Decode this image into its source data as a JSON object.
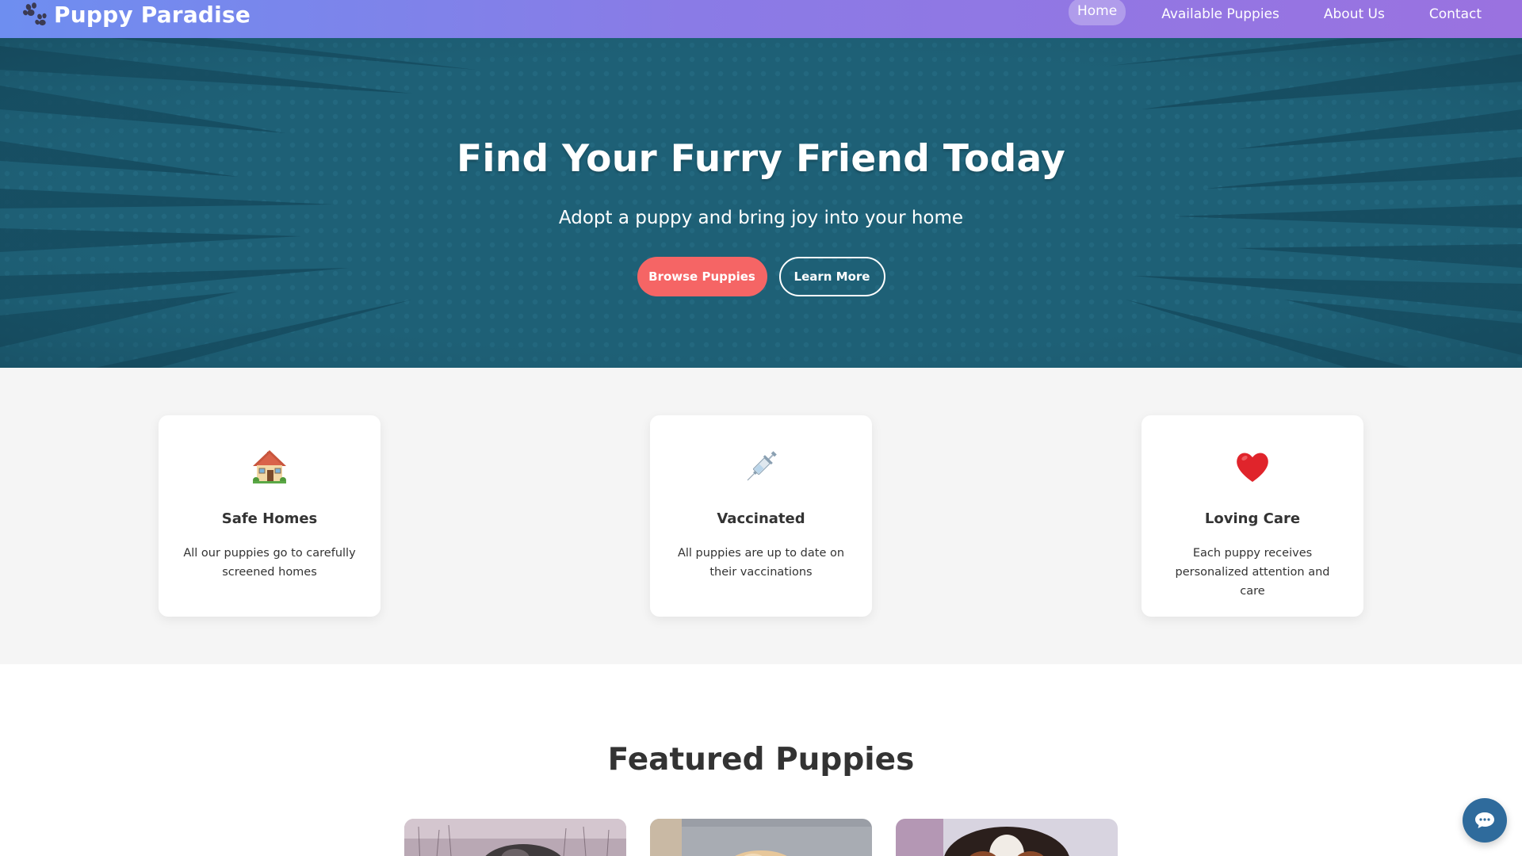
{
  "brand": {
    "title": "Puppy Paradise",
    "logo_icon": "paw-icon"
  },
  "nav": {
    "items": [
      {
        "label": "Home",
        "active": true
      },
      {
        "label": "Available Puppies",
        "active": false
      },
      {
        "label": "About Us",
        "active": false
      },
      {
        "label": "Contact",
        "active": false
      }
    ]
  },
  "hero": {
    "title": "Find Your Furry Friend Today",
    "subtitle": "Adopt a puppy and bring joy into your home",
    "primary_button": "Browse Puppies",
    "secondary_button": "Learn More"
  },
  "features": [
    {
      "icon": "house-icon",
      "title": "Safe Homes",
      "description": "All our puppies go to carefully screened homes"
    },
    {
      "icon": "syringe-icon",
      "title": "Vaccinated",
      "description": "All puppies are up to date on their vaccinations"
    },
    {
      "icon": "heart-icon",
      "title": "Loving Care",
      "description": "Each puppy receives personalized attention and care"
    }
  ],
  "featured": {
    "title": "Featured Puppies",
    "cards": [
      {
        "image": "puppy-photo-snow"
      },
      {
        "image": "puppy-photo-couch"
      },
      {
        "image": "puppy-photo-portrait"
      }
    ]
  },
  "chat": {
    "icon": "chat-bubble-icon"
  },
  "colors": {
    "nav_gradient_start": "#6e8ef0",
    "nav_gradient_end": "#9a72e0",
    "hero_bg": "#1e6076",
    "primary_button": "#f56565",
    "features_bg": "#f5f5f5",
    "chat_button": "#2f6b9c"
  }
}
